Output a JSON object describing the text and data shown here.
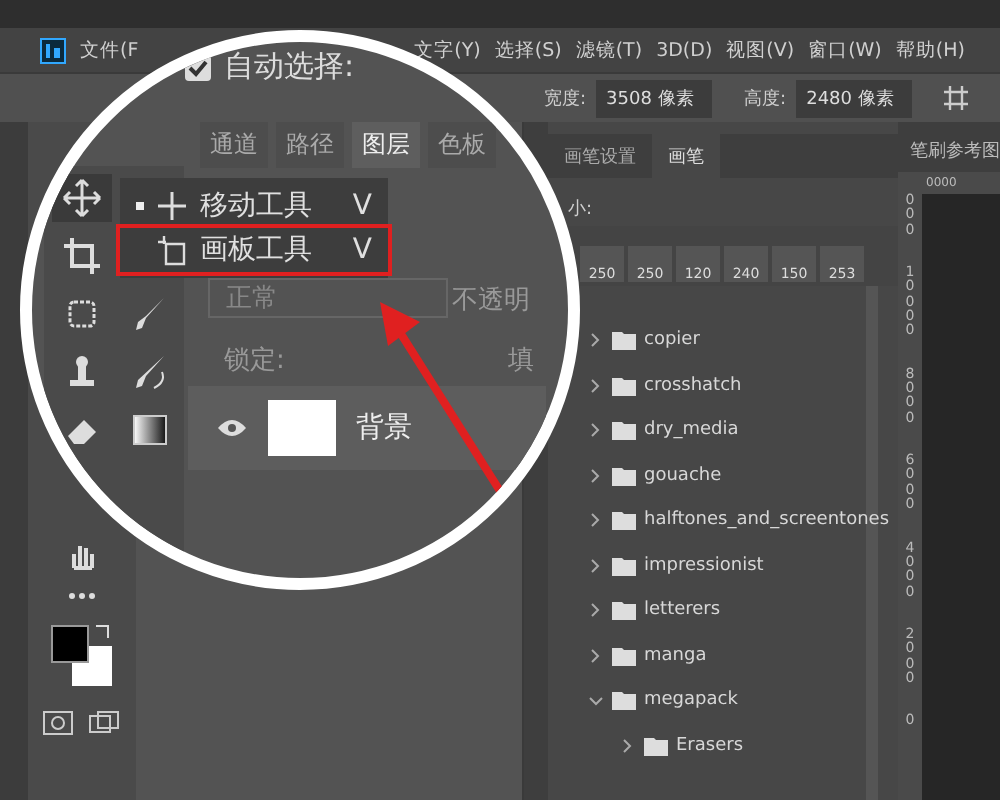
{
  "menu_bar": {
    "items": [
      "文件(F",
      "文字(Y)",
      "选择(S)",
      "滤镜(T)",
      "3D(D)",
      "视图(V)",
      "窗口(W)",
      "帮助(H)"
    ]
  },
  "options_bar": {
    "width_label": "宽度:",
    "width_value": "3508 像素",
    "height_label": "高度:",
    "height_value": "2480 像素"
  },
  "magnifier": {
    "auto_select": {
      "label": "自动选择:",
      "checked": true
    },
    "panel_tabs": [
      {
        "label": "通道",
        "selected": false
      },
      {
        "label": "路径",
        "selected": false
      },
      {
        "label": "图层",
        "selected": true
      },
      {
        "label": "色板",
        "selected": false
      }
    ],
    "tool_menu": [
      {
        "label": "移动工具",
        "shortcut": "V",
        "selected": true,
        "highlighted": false
      },
      {
        "label": "画板工具",
        "shortcut": "V",
        "selected": false,
        "highlighted": true
      }
    ],
    "blend_mode": "正常",
    "opacity_label": "不透明",
    "lock_label": "锁定:",
    "fill_label": "填",
    "layer": {
      "name": "背景",
      "visible": true
    }
  },
  "brush_panel": {
    "tabs": [
      {
        "label": "画笔设置",
        "selected": false
      },
      {
        "label": "画笔",
        "selected": true
      }
    ],
    "size_label": "小:",
    "presets": [
      "250",
      "250",
      "120",
      "240",
      "150",
      "253"
    ],
    "folders": [
      {
        "name": "copier",
        "expanded": false
      },
      {
        "name": "crosshatch",
        "expanded": false
      },
      {
        "name": "dry_media",
        "expanded": false
      },
      {
        "name": "gouache",
        "expanded": false
      },
      {
        "name": "halftones_and_screentones",
        "expanded": false
      },
      {
        "name": "impressionist",
        "expanded": false
      },
      {
        "name": "letterers",
        "expanded": false
      },
      {
        "name": "manga",
        "expanded": false
      },
      {
        "name": "megapack",
        "expanded": true,
        "children": [
          {
            "name": "Erasers",
            "expanded": false
          }
        ]
      }
    ]
  },
  "reference_panel": {
    "title": "笔刷参考图",
    "top_ruler": "0000",
    "side_ruler": [
      "000",
      "10000",
      "8000",
      "6000",
      "4000",
      "2000",
      "0"
    ]
  }
}
